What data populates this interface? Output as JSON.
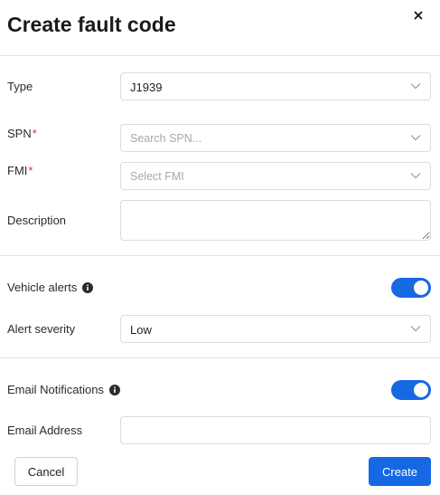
{
  "header": {
    "title": "Create fault code",
    "close_icon": "close-icon"
  },
  "form": {
    "type": {
      "label": "Type",
      "value": "J1939"
    },
    "spn": {
      "label": "SPN",
      "required_mark": "*",
      "placeholder": "Search SPN..."
    },
    "fmi": {
      "label": "FMI",
      "required_mark": "*",
      "placeholder": "Select FMI"
    },
    "description": {
      "label": "Description",
      "value": ""
    },
    "vehicle_alerts": {
      "label": "Vehicle alerts",
      "enabled": true
    },
    "alert_severity": {
      "label": "Alert severity",
      "value": "Low"
    },
    "email_notifications": {
      "label": "Email Notifications",
      "enabled": true
    },
    "email_address": {
      "label": "Email Address",
      "value": ""
    }
  },
  "footer": {
    "cancel_label": "Cancel",
    "create_label": "Create"
  },
  "colors": {
    "accent": "#1668e3",
    "required": "#d93025"
  }
}
